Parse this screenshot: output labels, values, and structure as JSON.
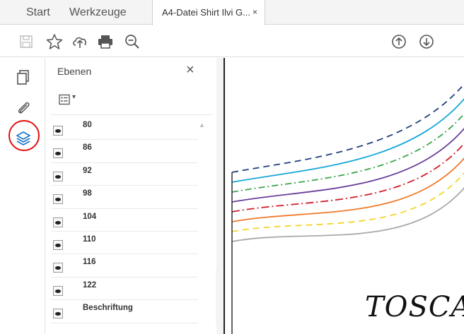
{
  "menu": {
    "tabs": [
      {
        "label": "Start"
      },
      {
        "label": "Werkzeuge"
      }
    ],
    "document_tab": {
      "title": "A4-Datei Shirt Ilvi G...",
      "close_symbol": "×"
    }
  },
  "toolbar": {
    "icons": [
      "save-icon",
      "star-icon",
      "upload-cloud-icon",
      "print-icon",
      "zoom-out-icon",
      "page-up-icon",
      "page-down-icon"
    ]
  },
  "rail": {
    "icons": [
      "pages-icon",
      "attachment-icon",
      "layers-icon"
    ],
    "active": "layers-icon"
  },
  "layers_panel": {
    "title": "Ebenen",
    "close_symbol": "×",
    "options_arrow": "▾",
    "layers": [
      {
        "label": "80"
      },
      {
        "label": "86"
      },
      {
        "label": "92"
      },
      {
        "label": "98"
      },
      {
        "label": "104"
      },
      {
        "label": "110"
      },
      {
        "label": "116"
      },
      {
        "label": "122"
      },
      {
        "label": "Beschriftung"
      }
    ]
  },
  "document": {
    "brand_text": "TOSCA",
    "line_colors": [
      "#1f3f7a",
      "#16a6d9",
      "#3aa64a",
      "#6a3f9a",
      "#d11f2a",
      "#f07a2a",
      "#f2d630",
      "#a9a9a9"
    ]
  },
  "colors": {
    "accent_blue": "#1877c9",
    "highlight_ring": "#e01010"
  }
}
